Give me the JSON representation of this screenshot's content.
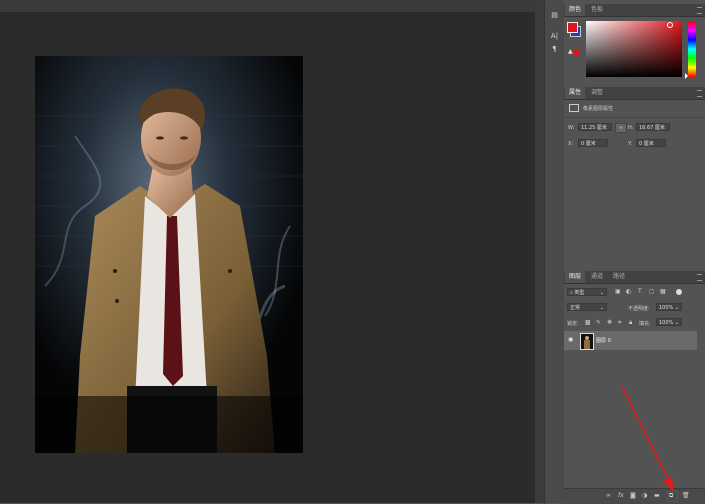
{
  "color_panel": {
    "tabs": [
      "颜色",
      "色板"
    ]
  },
  "properties_panel": {
    "tabs": [
      "属性",
      "调整"
    ],
    "title": "像素图层属性",
    "w_label": "W:",
    "w_value": "11.25 厘米",
    "h_label": "H:",
    "h_value": "16.67 厘米",
    "x_label": "X:",
    "x_value": "0 厘米",
    "y_label": "Y:",
    "y_value": "0 厘米"
  },
  "layers_panel": {
    "tabs": [
      "图层",
      "通道",
      "路径"
    ],
    "filter_kind": "类型",
    "blend_mode": "正常",
    "opacity_label": "不透明度:",
    "opacity_value": "100%",
    "lock_label": "锁定:",
    "fill_label": "填充:",
    "fill_value": "100%",
    "layers": [
      {
        "name": "图层 0",
        "visible": true,
        "selected": true
      }
    ],
    "footer_fx": "fx"
  },
  "colors": {
    "foreground": "#e0161b",
    "background": "#1f3ad4",
    "annotation_arrow": "#e11a1a"
  }
}
